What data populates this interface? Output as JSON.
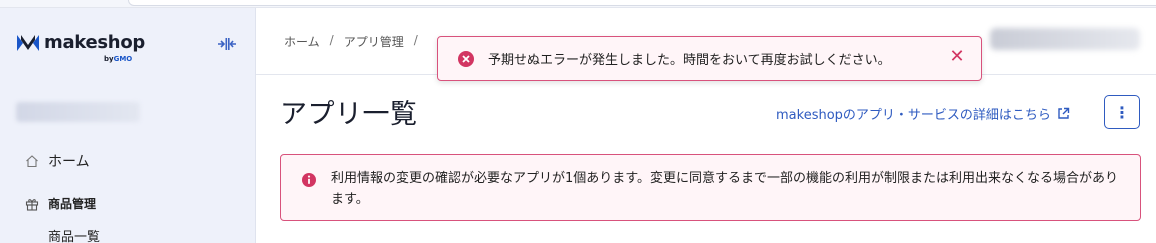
{
  "logo": {
    "name": "makeshop",
    "sub_by": "by",
    "sub_brand": "GMO"
  },
  "sidebar": {
    "collapse_icon": "collapse-sidebar-icon",
    "items": [
      {
        "label": "ホーム",
        "icon": "home-icon"
      },
      {
        "label": "商品管理",
        "icon": "gift-icon"
      },
      {
        "label": "商品一覧"
      }
    ]
  },
  "breadcrumb": {
    "items": [
      "ホーム",
      "アプリ管理"
    ],
    "separator": "/"
  },
  "toast": {
    "message": "予期せぬエラーが発生しました。時間をおいて再度お試しください。",
    "close_label": "✕",
    "color": "#d23562"
  },
  "page": {
    "title": "アプリ一覧",
    "detail_link": "makeshopのアプリ・サービスの詳細はこちら",
    "more_label": "⋮"
  },
  "alert": {
    "message": "利用情報の変更の確認が必要なアプリが1個あります。変更に同意するまで一部の機能の利用が制限または利用出来なくなる場合があります。",
    "color": "#d8527c"
  },
  "colors": {
    "accent": "#2f5bc0",
    "error": "#d23562",
    "sidebar_bg": "#eef1fa"
  }
}
